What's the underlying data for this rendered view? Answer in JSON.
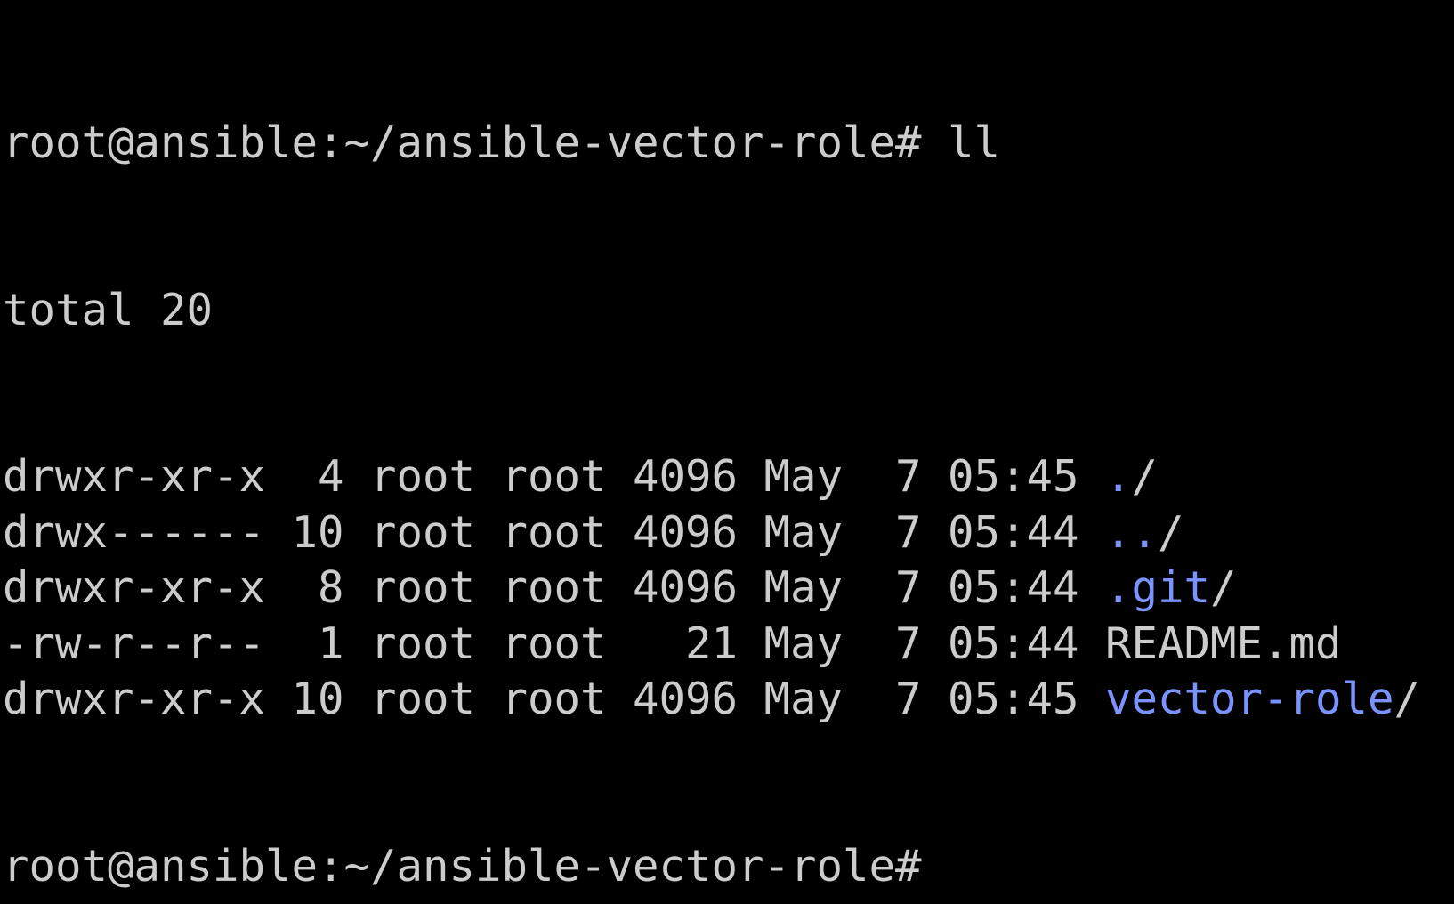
{
  "terminal": {
    "prompt": "root@ansible:~/ansible-vector-role#",
    "command": " ll",
    "total_line": "total 20",
    "final_prompt": "root@ansible:~/ansible-vector-role#",
    "rows": [
      {
        "perms": "drwxr-xr-x",
        "links": " 4",
        "owner": "root",
        "group": "root",
        "size": "4096",
        "month": "May",
        "day": " 7",
        "time": "05:45",
        "name": ".",
        "trail": "/",
        "is_dir": true
      },
      {
        "perms": "drwx------",
        "links": "10",
        "owner": "root",
        "group": "root",
        "size": "4096",
        "month": "May",
        "day": " 7",
        "time": "05:44",
        "name": "..",
        "trail": "/",
        "is_dir": true
      },
      {
        "perms": "drwxr-xr-x",
        "links": " 8",
        "owner": "root",
        "group": "root",
        "size": "4096",
        "month": "May",
        "day": " 7",
        "time": "05:44",
        "name": ".git",
        "trail": "/",
        "is_dir": true
      },
      {
        "perms": "-rw-r--r--",
        "links": " 1",
        "owner": "root",
        "group": "root",
        "size": "  21",
        "month": "May",
        "day": " 7",
        "time": "05:44",
        "name": "README.md",
        "trail": "",
        "is_dir": false
      },
      {
        "perms": "drwxr-xr-x",
        "links": "10",
        "owner": "root",
        "group": "root",
        "size": "4096",
        "month": "May",
        "day": " 7",
        "time": "05:45",
        "name": "vector-role",
        "trail": "/",
        "is_dir": true
      }
    ]
  },
  "colors": {
    "background": "#000000",
    "text": "#cccccc",
    "directory": "#7b93ff"
  }
}
